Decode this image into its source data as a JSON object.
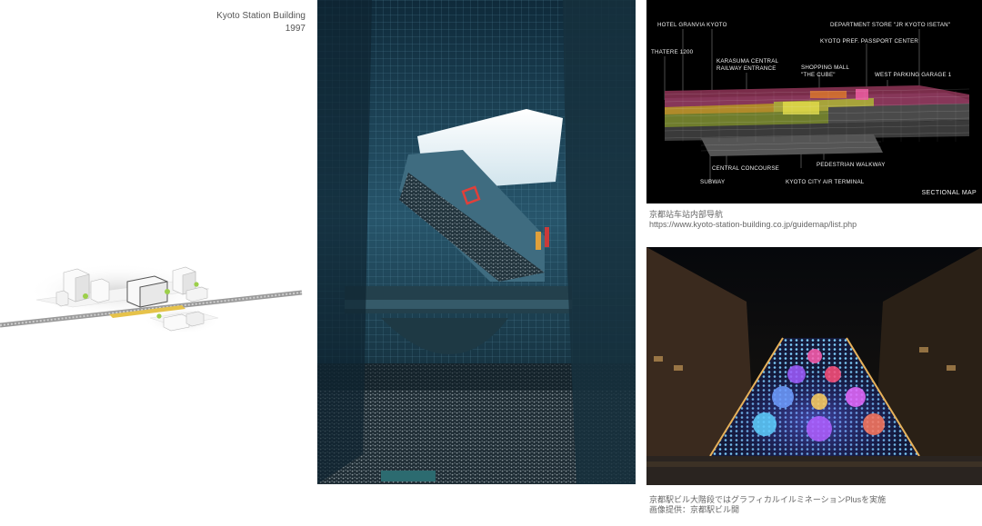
{
  "header": {
    "title": "Kyoto Station Building",
    "year": "1997"
  },
  "sectional_map": {
    "labels": {
      "hotel": "HOTEL GRANVIA KYOTO",
      "isetan": "DEPARTMENT STORE \"JR KYOTO ISETAN\"",
      "passport": "KYOTO PREF. PASSPORT CENTER",
      "theatre": "THATERE 1200",
      "karasuma_1": "KARASUMA CENTRAL",
      "karasuma_2": "RAILWAY ENTRANCE",
      "cube_1": "SHOPPING MALL",
      "cube_2": "\"THE CUBE\"",
      "parking": "WEST PARKING GARAGE 1",
      "concourse": "CENTRAL CONCOURSE",
      "walkway": "PEDESTRIAN WALKWAY",
      "subway": "SUBWAY",
      "air_terminal": "KYOTO CITY AIR TERMINAL",
      "map_title": "SECTIONAL MAP"
    }
  },
  "captions": {
    "map_caption_line1": "京都站车站内部导航",
    "map_caption_line2": "https://www.kyoto-station-building.co.jp/guidemap/list.php",
    "stairs_caption_line1": "京都駅ビル大階段ではグラフィカルイルミネーションPlusを実施",
    "stairs_caption_line2": "画像提供：京都駅ビル開"
  }
}
